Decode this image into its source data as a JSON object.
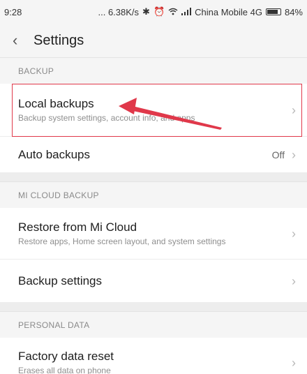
{
  "status_bar": {
    "time": "9:28",
    "speed": "... 6.38K/s",
    "bluetooth_icon": "bluetooth-icon",
    "alarm_icon": "alarm-icon",
    "wifi_icon": "wifi-icon",
    "signal_icon": "signal-icon",
    "carrier": "China Mobile 4G",
    "battery_percent": "84%",
    "battery_level": 0.84
  },
  "header": {
    "back_icon": "chevron-left-icon",
    "title": "Settings"
  },
  "sections": {
    "backup": {
      "header": "BACKUP",
      "local_backups": {
        "title": "Local backups",
        "subtitle": "Backup system settings, account info, and apps"
      },
      "auto_backups": {
        "title": "Auto backups",
        "value": "Off"
      }
    },
    "mi_cloud": {
      "header": "MI CLOUD BACKUP",
      "restore": {
        "title": "Restore from Mi Cloud",
        "subtitle": "Restore apps, Home screen layout, and system settings"
      },
      "backup_settings": {
        "title": "Backup settings"
      }
    },
    "personal_data": {
      "header": "PERSONAL DATA",
      "factory_reset": {
        "title": "Factory data reset",
        "subtitle": "Erases all data on phone"
      }
    }
  },
  "annotation": {
    "color": "#e0384a"
  }
}
